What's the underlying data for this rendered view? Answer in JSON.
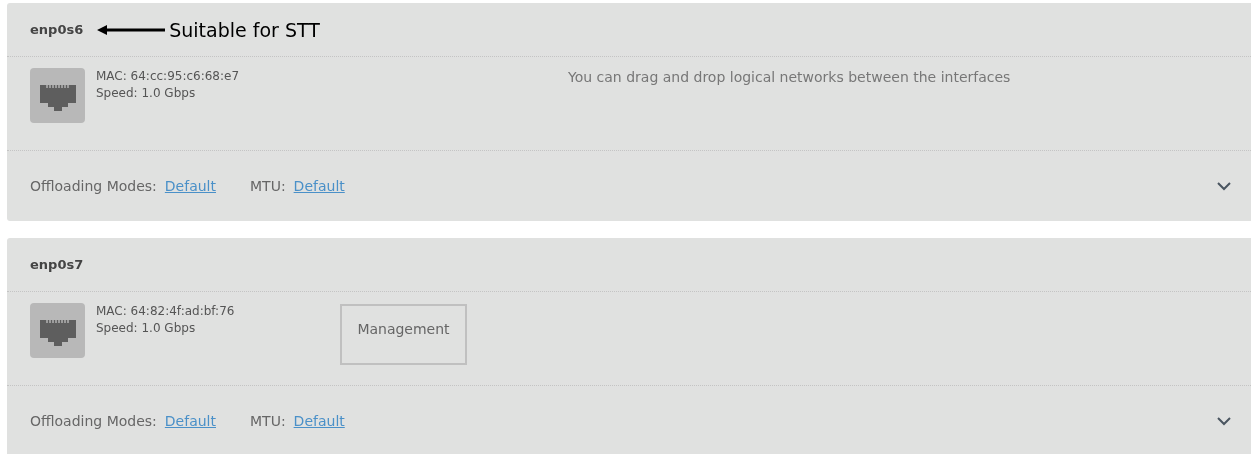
{
  "interfaces": [
    {
      "name": "enp0s6",
      "annotation": "Suitable for STT",
      "mac": "MAC: 64:cc:95:c6:68:e7",
      "speed": "Speed: 1.0 Gbps",
      "hint": "You can drag and drop logical networks between the interfaces",
      "offloading_label": "Offloading Modes:",
      "offloading_value": "Default",
      "mtu_label": "MTU:",
      "mtu_value": "Default",
      "expanded": false
    },
    {
      "name": "enp0s7",
      "mac": "MAC: 64:82:4f:ad:bf:76",
      "speed": "Speed: 1.0 Gbps",
      "networks": [
        "Management"
      ],
      "offloading_label": "Offloading Modes:",
      "offloading_value": "Default",
      "mtu_label": "MTU:",
      "mtu_value": "Default",
      "expanded": false
    }
  ]
}
